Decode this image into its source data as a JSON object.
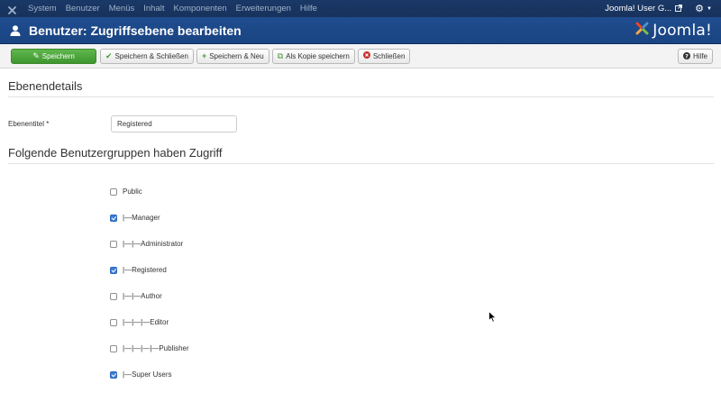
{
  "topnav": {
    "menu": [
      "System",
      "Benutzer",
      "Menüs",
      "Inhalt",
      "Komponenten",
      "Erweiterungen",
      "Hilfe"
    ],
    "user_label": "Joomla! User G...",
    "external_icon": "external-link-icon",
    "settings_icon": "gear-icon"
  },
  "header": {
    "title": "Benutzer: Zugriffsebene bearbeiten",
    "brand": "Joomla!"
  },
  "toolbar": {
    "save": "Speichern",
    "save_close": "Speichern & Schließen",
    "save_new": "Speichern & Neu",
    "save_copy": "Als Kopie speichern",
    "close": "Schließen",
    "help": "Hilfe"
  },
  "form": {
    "section_details": "Ebenendetails",
    "title_label": "Ebenentitel *",
    "title_value": "Registered",
    "section_groups": "Folgende Benutzergruppen haben Zugriff",
    "groups": [
      {
        "label": "Public",
        "checked": false
      },
      {
        "label": "|—Manager",
        "checked": true
      },
      {
        "label": "|—|—Administrator",
        "checked": false
      },
      {
        "label": "|—Registered",
        "checked": true
      },
      {
        "label": "|—|—Author",
        "checked": false
      },
      {
        "label": "|—|—|—Editor",
        "checked": false
      },
      {
        "label": "|—|—|—|—Publisher",
        "checked": false
      },
      {
        "label": "|—Super Users",
        "checked": true
      }
    ]
  },
  "colors": {
    "topnav_bg": "#17325c",
    "header_bg": "#1a4482",
    "save_button": "#48a23a",
    "checkbox_checked": "#3d7fd8"
  }
}
